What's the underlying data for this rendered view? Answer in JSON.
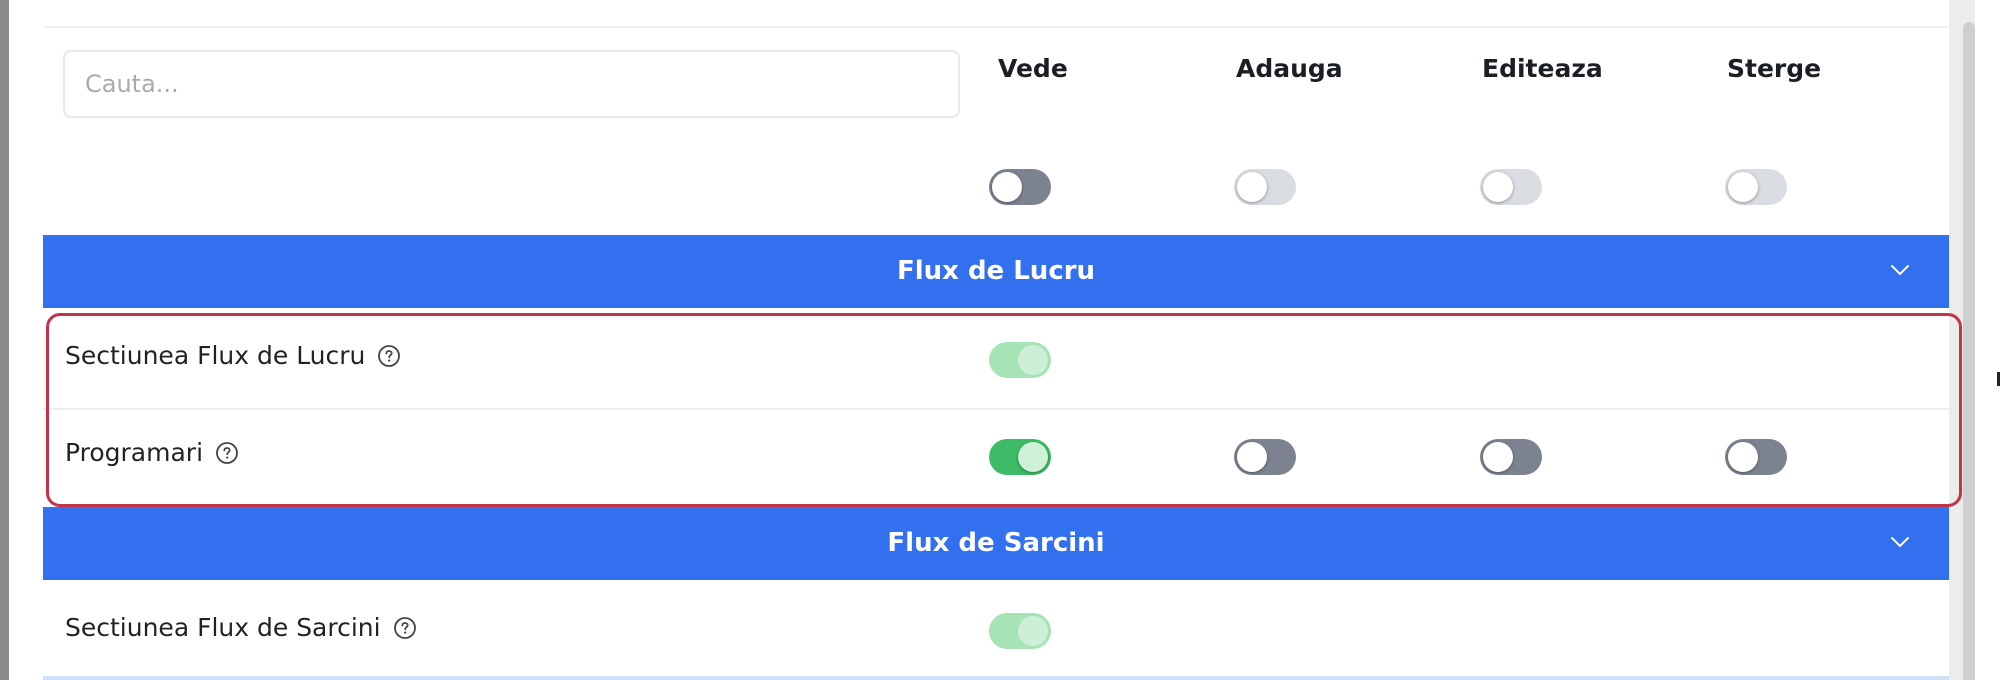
{
  "search": {
    "placeholder": "Cauta..."
  },
  "columns": [
    "Vede",
    "Adauga",
    "Editeaza",
    "Sterge"
  ],
  "header_toggles": [
    {
      "column": "Vede",
      "state": "off"
    },
    {
      "column": "Adauga",
      "state": "off"
    },
    {
      "column": "Editeaza",
      "state": "off"
    },
    {
      "column": "Sterge",
      "state": "off"
    }
  ],
  "groups": [
    {
      "title": "Flux de Lucru",
      "rows": [
        {
          "label": "Sectiunea Flux de Lucru",
          "toggles": [
            {
              "column": "Vede",
              "state": "on"
            }
          ]
        },
        {
          "label": "Programari",
          "toggles": [
            {
              "column": "Vede",
              "state": "on"
            },
            {
              "column": "Adauga",
              "state": "off"
            },
            {
              "column": "Editeaza",
              "state": "off"
            },
            {
              "column": "Sterge",
              "state": "off"
            }
          ]
        }
      ]
    },
    {
      "title": "Flux de Sarcini",
      "rows": [
        {
          "label": "Sectiunea Flux de Sarcini",
          "toggles": [
            {
              "column": "Vede",
              "state": "on"
            }
          ]
        }
      ]
    }
  ],
  "icons": {
    "help": "help-circle-icon",
    "chevron": "chevron-down-icon"
  },
  "colors": {
    "band": "#3370f0",
    "toggle_on": "#3dbb66",
    "highlight_border": "#c2344a"
  }
}
